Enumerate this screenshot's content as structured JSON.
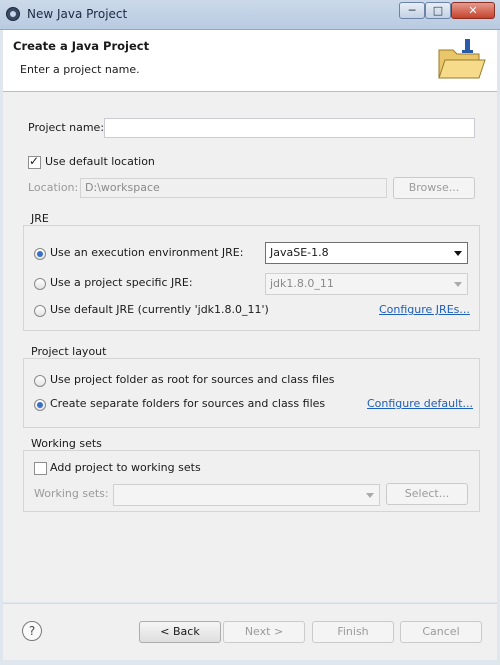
{
  "window": {
    "title": "New Java Project",
    "min": "─",
    "max": "□",
    "close": "✕"
  },
  "header": {
    "title": "Create a Java Project",
    "description": "Enter a project name."
  },
  "project": {
    "name_label": "Project name:",
    "name_value": ""
  },
  "location": {
    "use_default_label": "Use default location",
    "use_default_checked": true,
    "label": "Location:",
    "value": "D:\\workspace",
    "browse_label": "Browse..."
  },
  "jre": {
    "group_label": "JRE",
    "options": [
      {
        "label": "Use an execution environment JRE:",
        "selected": true,
        "value": "JavaSE-1.8"
      },
      {
        "label": "Use a project specific JRE:",
        "selected": false,
        "value": "jdk1.8.0_11"
      },
      {
        "label": "Use default JRE (currently 'jdk1.8.0_11')",
        "selected": false
      }
    ],
    "configure_link": "Configure JREs..."
  },
  "layout": {
    "group_label": "Project layout",
    "options": [
      {
        "label": "Use project folder as root for sources and class files",
        "selected": false
      },
      {
        "label": "Create separate folders for sources and class files",
        "selected": true
      }
    ],
    "configure_link": "Configure default..."
  },
  "working_sets": {
    "group_label": "Working sets",
    "add_label": "Add project to working sets",
    "add_checked": false,
    "sets_label": "Working sets:",
    "select_label": "Select..."
  },
  "footer": {
    "help": "?",
    "back": "< Back",
    "next": "Next >",
    "finish": "Finish",
    "cancel": "Cancel"
  },
  "icons": {
    "app": "eclipse-icon",
    "wizard": "new-java-project-folder-icon",
    "help": "help-icon"
  }
}
